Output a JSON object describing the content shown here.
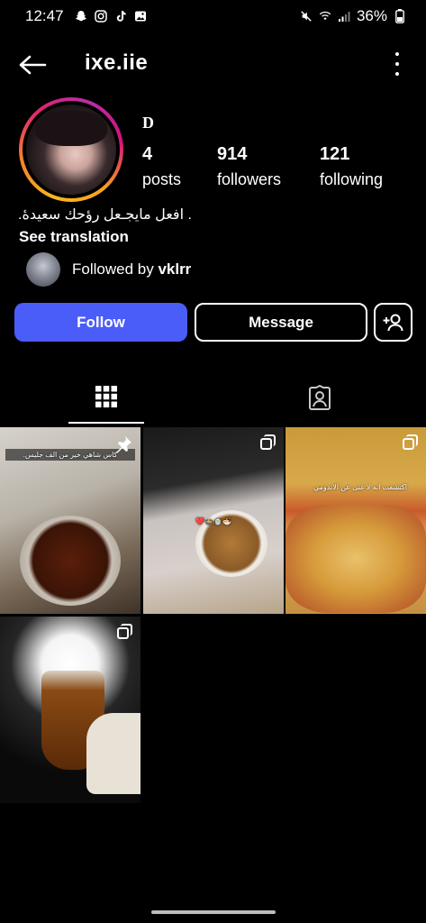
{
  "status_bar": {
    "time": "12:47",
    "battery": "36%",
    "icons": [
      "snapchat-icon",
      "instagram-icon",
      "tiktok-icon",
      "gallery-icon",
      "mute-icon",
      "wifi-icon",
      "signal-icon",
      "battery-icon"
    ]
  },
  "header": {
    "username": "ixe.iie"
  },
  "profile": {
    "display_name": "D",
    "stats": {
      "posts": {
        "value": "4",
        "label": "posts"
      },
      "followers": {
        "value": "914",
        "label": "followers"
      },
      "following": {
        "value": "121",
        "label": "following"
      }
    },
    "bio": ". افعل مايجـعل رؤحك سعيدهٔ.",
    "see_translation": "See translation",
    "followed_by_prefix": "Followed by ",
    "followed_by_user": "vklrr"
  },
  "actions": {
    "follow": "Follow",
    "message": "Message"
  },
  "tabs": [
    "posts-grid-tab",
    "tagged-tab"
  ],
  "posts": [
    {
      "caption": "كاس شاهي خير من الف جليس.",
      "badge": "pinned-icon"
    },
    {
      "caption": "🍜🍵🍲❤️",
      "badge": "multiple-icon"
    },
    {
      "caption": "اكتشفت انه لا غنى عن الاندومي",
      "badge": "multiple-icon"
    },
    {
      "caption": "",
      "badge": "multiple-icon"
    }
  ],
  "colors": {
    "background": "#000000",
    "follow_button": "#4a5df9",
    "text": "#ffffff"
  }
}
